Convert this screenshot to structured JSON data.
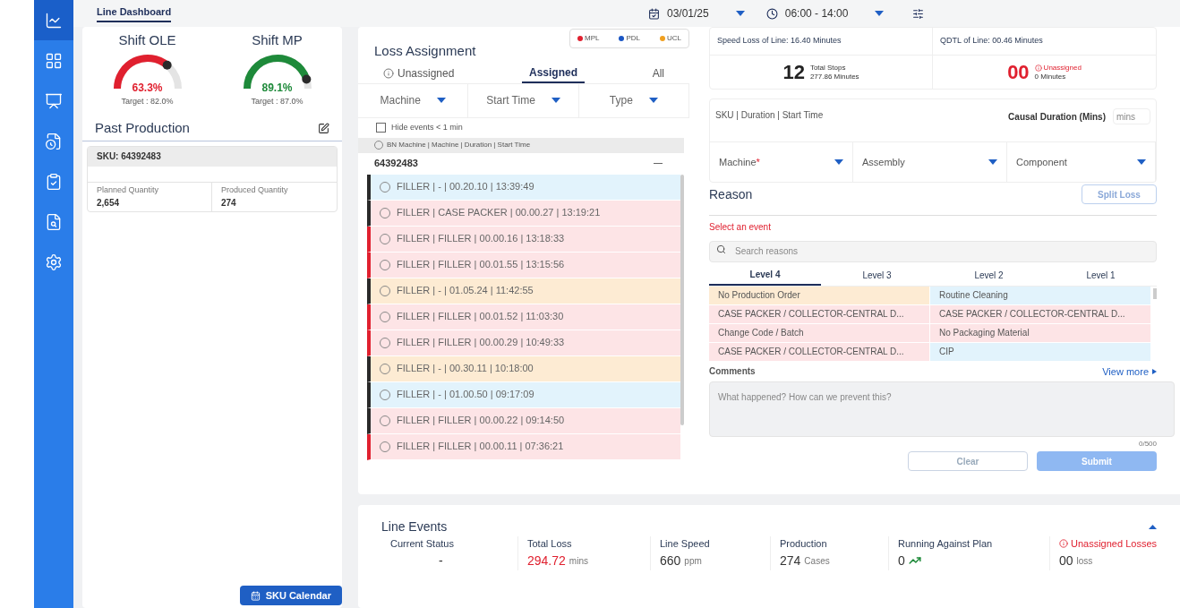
{
  "sidebar": {
    "items": [
      {
        "selected": true
      },
      {
        "selected": false
      },
      {
        "selected": false
      },
      {
        "selected": false
      },
      {
        "selected": false
      },
      {
        "selected": false
      },
      {
        "selected": false
      }
    ]
  },
  "top_bar": {
    "tabs": [
      {
        "label": "Line Dashboard",
        "selected": true
      }
    ],
    "date": "03/01/25",
    "shift": "06:00 - 14:00"
  },
  "gauges": [
    {
      "title": "Shift OLE",
      "value": "63.3%",
      "target": "Target : 82.0%",
      "color": "#e0202f"
    },
    {
      "title": "Shift MP",
      "value": "89.1%",
      "target": "Target : 87.0%",
      "color": "#1e8a3a"
    }
  ],
  "past_production": {
    "title": "Past Production",
    "sku": "SKU: 64392483",
    "fields": [
      {
        "label": "Planned Quantity",
        "value": "2,654"
      },
      {
        "label": "Produced Quantity",
        "value": "274"
      }
    ],
    "button": "SKU Calendar"
  },
  "loss_assignment": {
    "title": "Loss Assignment",
    "legend": [
      {
        "label": "MPL",
        "color": "#e0202f"
      },
      {
        "label": "PDL",
        "color": "#1a56c4"
      },
      {
        "label": "UCL",
        "color": "#f0a020"
      }
    ],
    "tabs": [
      {
        "label": "Unassigned",
        "selected": false
      },
      {
        "label": "Assigned",
        "selected": true
      },
      {
        "label": "All",
        "selected": false
      }
    ],
    "filters": [
      "Machine",
      "Start Time",
      "Type"
    ],
    "hide_short": {
      "label": "Hide events < 1 min",
      "checked": false
    },
    "header": "BN Machine | Machine | Duration | Start Time",
    "group": "64392483",
    "group_expanded": true,
    "events": [
      {
        "text": "FILLER | - | 00.20.10 | 13:39:49",
        "color": "#e2f3fc",
        "flagged": false
      },
      {
        "text": "FILLER | CASE PACKER | 00.00.27 | 13:19:21",
        "color": "#fde4e6",
        "flagged": false
      },
      {
        "text": "FILLER | FILLER | 00.00.16 | 13:18:33",
        "color": "#fde4e6",
        "flagged": true
      },
      {
        "text": "FILLER | FILLER | 00.01.55 | 13:15:56",
        "color": "#fde4e6",
        "flagged": true
      },
      {
        "text": "FILLER | - | 01.05.24 | 11:42:55",
        "color": "#fdebd3",
        "flagged": false
      },
      {
        "text": "FILLER | FILLER | 00.01.52 | 11:03:30",
        "color": "#fde4e6",
        "flagged": true
      },
      {
        "text": "FILLER | FILLER | 00.00.29 | 10:49:33",
        "color": "#fde4e6",
        "flagged": true
      },
      {
        "text": "FILLER | - | 00.30.11 | 10:18:00",
        "color": "#fdebd3",
        "flagged": false
      },
      {
        "text": "FILLER | - | 01.00.50 | 09:17:09",
        "color": "#e2f3fc",
        "flagged": false
      },
      {
        "text": "FILLER | FILLER | 00.00.22 | 09:14:50",
        "color": "#fde4e6",
        "flagged": false
      },
      {
        "text": "FILLER | FILLER | 00.00.11 | 07:36:21",
        "color": "#fde4e6",
        "flagged": true
      }
    ]
  },
  "summary": {
    "speed_loss": "Speed Loss of Line:  16.40 Minutes",
    "qdtl": "QDTL of Line:  00.46 Minutes",
    "stops_count": "12",
    "stops_label": "Total Stops",
    "stops_minutes": "277.86 Minutes",
    "unassigned_count": "00",
    "unassigned_label": "Unassigned",
    "unassigned_minutes": "0 Minutes"
  },
  "assign_form": {
    "event_header": "SKU | Duration | Start Time",
    "causal_label": "Causal Duration (Mins)",
    "causal_placeholder": "mins",
    "required_mark": "*",
    "selects": [
      {
        "label": "Machine",
        "required": true
      },
      {
        "label": "Assembly",
        "required": false
      },
      {
        "label": "Component",
        "required": false
      }
    ],
    "reason_title": "Reason",
    "split_button": "Split Loss",
    "error": "Select an event",
    "search_placeholder": "Search reasons",
    "levels": [
      {
        "label": "Level 4",
        "selected": true
      },
      {
        "label": "Level 3",
        "selected": false
      },
      {
        "label": "Level 2",
        "selected": false
      },
      {
        "label": "Level 1",
        "selected": false
      }
    ],
    "reasons": [
      {
        "text": "No Production Order",
        "color": "#fdebd3"
      },
      {
        "text": "Routine Cleaning",
        "color": "#e2f3fc"
      },
      {
        "text": "CASE PACKER / COLLECTOR-CENTRAL D...",
        "color": "#fde4e6"
      },
      {
        "text": "CASE PACKER / COLLECTOR-CENTRAL D...",
        "color": "#fde4e6"
      },
      {
        "text": "Change Code / Batch",
        "color": "#fde4e6"
      },
      {
        "text": "No Packaging Material",
        "color": "#fde4e6"
      },
      {
        "text": "CASE PACKER / COLLECTOR-CENTRAL D...",
        "color": "#fde4e6"
      },
      {
        "text": "CIP",
        "color": "#e2f3fc"
      }
    ],
    "comments_label": "Comments",
    "view_more": "View more",
    "comments_placeholder": "What happened? How can we prevent this?",
    "counter": "0/500",
    "clear": "Clear",
    "submit": "Submit"
  },
  "line_events": {
    "title": "Line Events",
    "expanded": true,
    "stats": [
      {
        "label": "Current Status",
        "value": "-",
        "kind": "plain"
      },
      {
        "label": "Total Loss",
        "value": "294.72",
        "unit": "mins",
        "kind": "alert-value"
      },
      {
        "label": "Line Speed",
        "value": "660",
        "unit": "ppm",
        "kind": "plain"
      },
      {
        "label": "Production",
        "value": "274",
        "unit": "Cases",
        "kind": "plain"
      },
      {
        "label": "Running Against Plan",
        "value": "0",
        "kind": "trend"
      },
      {
        "label": "Unassigned Losses",
        "value": "00",
        "unit": "loss",
        "kind": "alert-label"
      }
    ]
  }
}
